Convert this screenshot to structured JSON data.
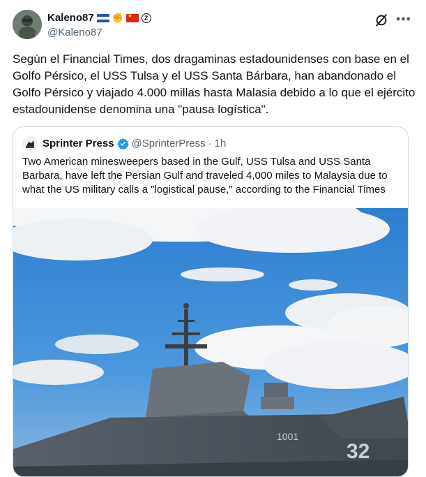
{
  "author": {
    "display_name": "Kaleno87",
    "handle": "@Kaleno87",
    "badges": [
      "el-salvador-flag",
      "handshake-emoji",
      "china-flag",
      "z-badge-icon"
    ]
  },
  "tweet": {
    "text": "Según el Financial Times, dos dragaminas estadounidenses con base en el Golfo Pérsico, el USS Tulsa y el USS Santa Bárbara, han abandonado el Golfo Pérsico y viajado 4.000 millas hasta Malasia debido a lo que el ejército estadounidense denomina una \"pausa logística\"."
  },
  "quote": {
    "display_name": "Sprinter Press",
    "handle": "@SprinterPress",
    "separator": "·",
    "time": "1h",
    "text": "Two American minesweepers based in the Gulf, USS Tulsa and USS Santa Barbara, have left the Persian Gulf and traveled 4,000 miles to Malaysia due to what the US military calls a \"logistical pause,\" according to the Financial Times",
    "image_hull_numbers": [
      "1001",
      "32"
    ]
  },
  "icons": {
    "grok": "grok-icon",
    "more": "more-icon",
    "verified": "verified-badge-icon"
  },
  "colors": {
    "text_primary": "#0f1419",
    "text_secondary": "#536471",
    "verified_blue": "#1d9bf0",
    "border": "#cfd9de"
  }
}
